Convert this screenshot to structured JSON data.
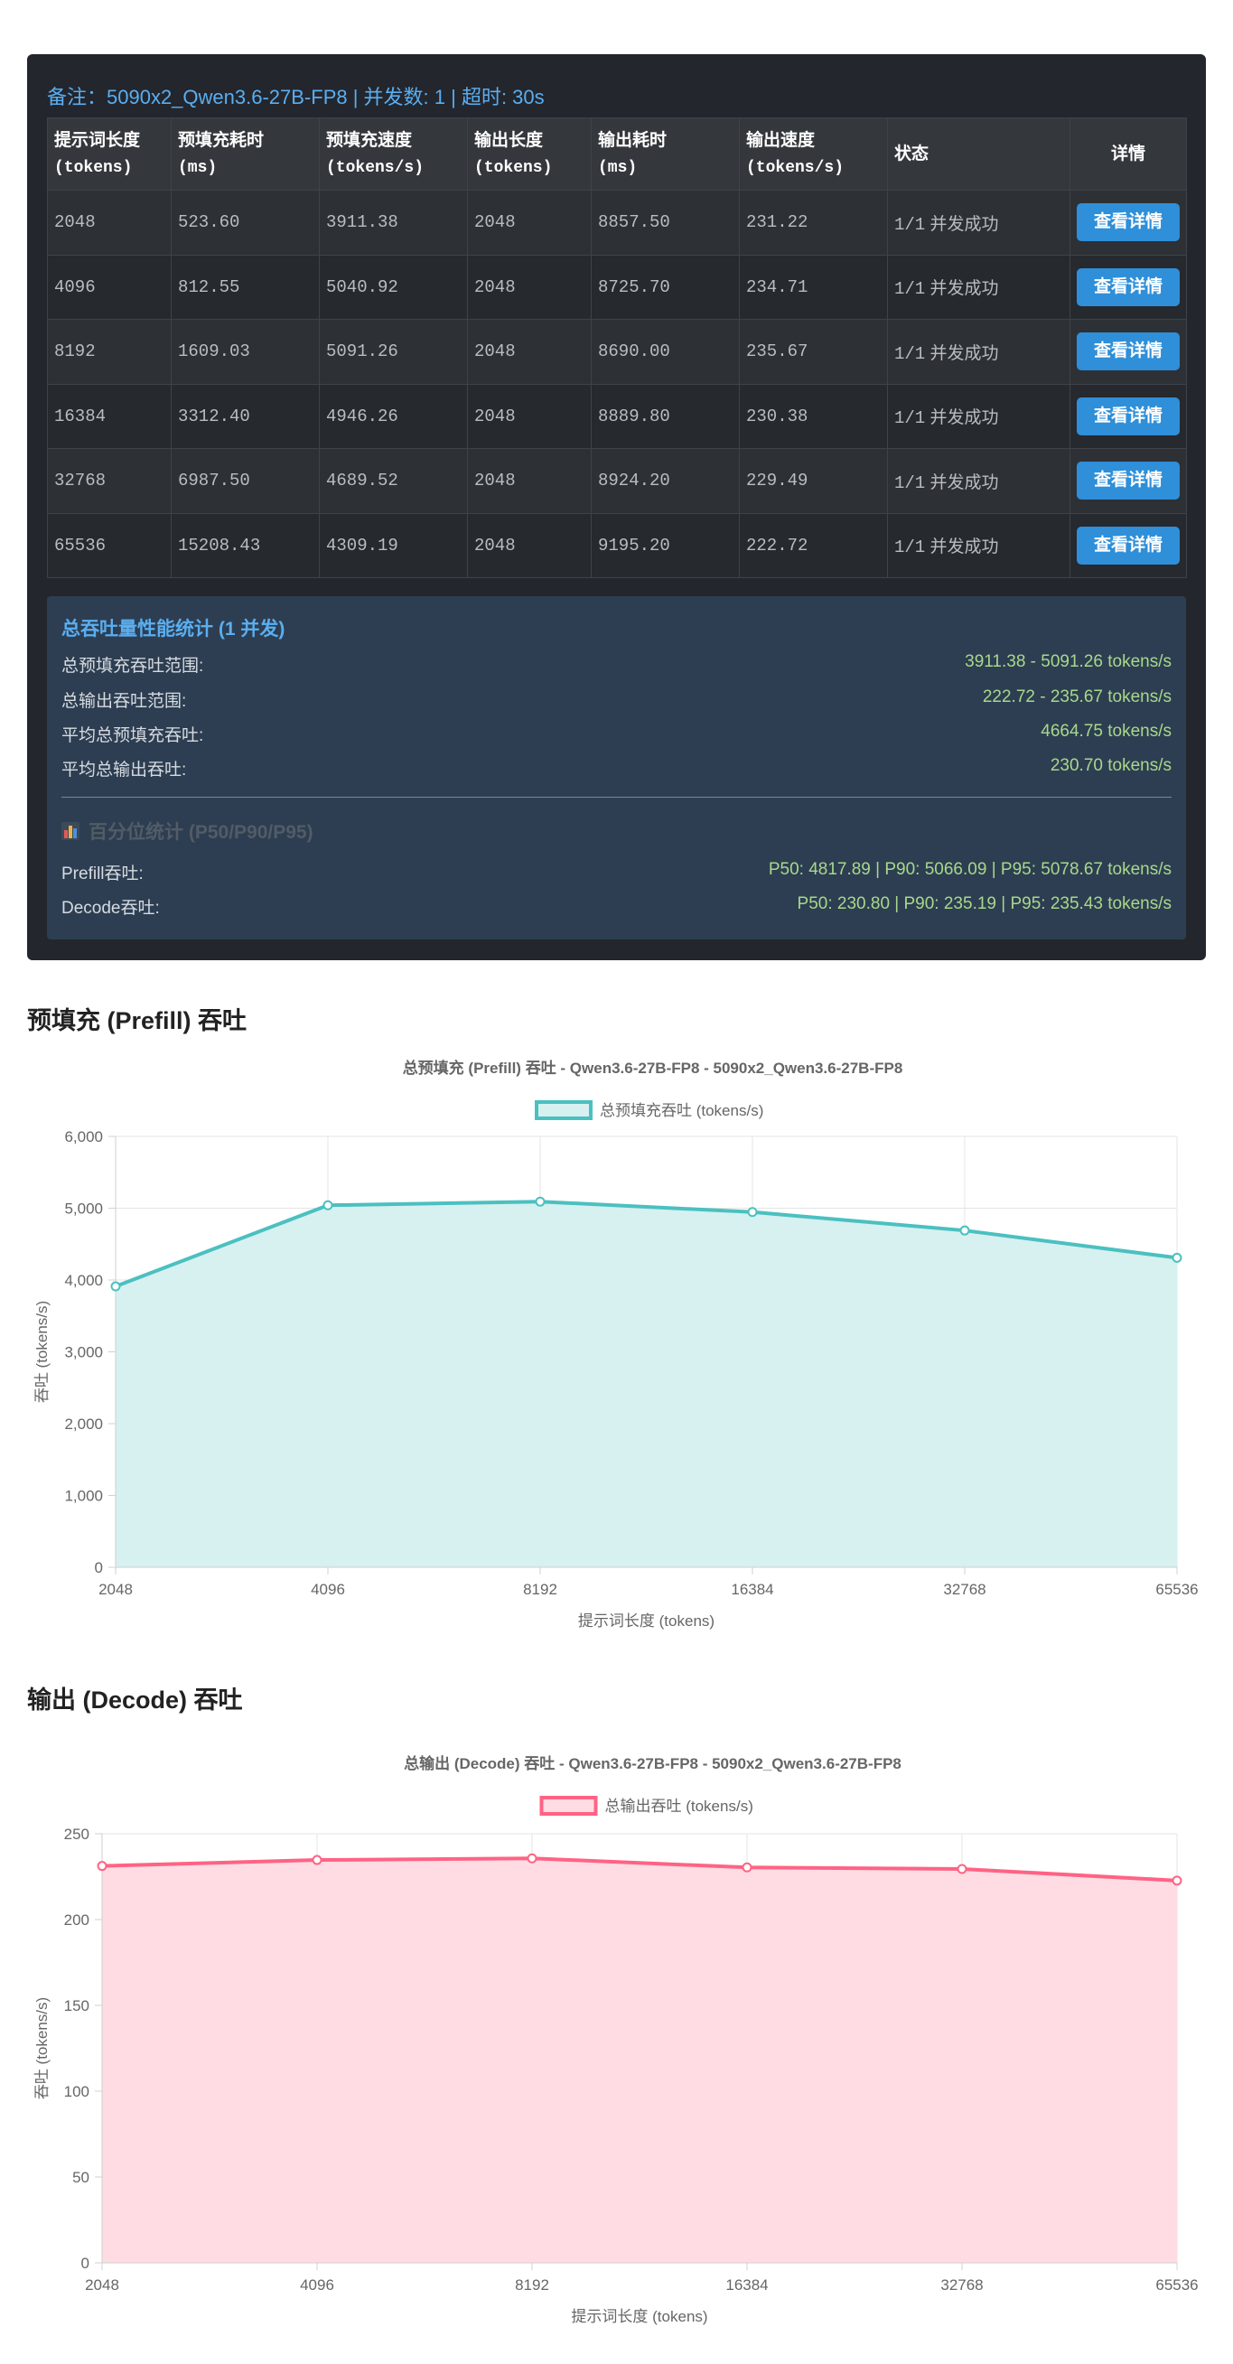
{
  "note": "备注：5090x2_Qwen3.6-27B-FP8 | 并发数: 1 | 超时: 30s",
  "table": {
    "headers": [
      {
        "title": "提示词长度",
        "unit": "(tokens)"
      },
      {
        "title": "预填充耗时",
        "unit": "(ms)"
      },
      {
        "title": "预填充速度",
        "unit": "(tokens/s)"
      },
      {
        "title": "输出长度",
        "unit": "(tokens)"
      },
      {
        "title": "输出耗时",
        "unit": "(ms)"
      },
      {
        "title": "输出速度",
        "unit": "(tokens/s)"
      },
      {
        "title": "状态",
        "unit": ""
      },
      {
        "title": "详情",
        "unit": ""
      }
    ],
    "rows": [
      {
        "prompt_len": "2048",
        "prefill_ms": "523.60",
        "prefill_speed": "3911.38",
        "output_len": "2048",
        "output_ms": "8857.50",
        "output_speed": "231.22",
        "status_frac": "1/1",
        "status_text": "并发成功",
        "button": "查看详情"
      },
      {
        "prompt_len": "4096",
        "prefill_ms": "812.55",
        "prefill_speed": "5040.92",
        "output_len": "2048",
        "output_ms": "8725.70",
        "output_speed": "234.71",
        "status_frac": "1/1",
        "status_text": "并发成功",
        "button": "查看详情"
      },
      {
        "prompt_len": "8192",
        "prefill_ms": "1609.03",
        "prefill_speed": "5091.26",
        "output_len": "2048",
        "output_ms": "8690.00",
        "output_speed": "235.67",
        "status_frac": "1/1",
        "status_text": "并发成功",
        "button": "查看详情"
      },
      {
        "prompt_len": "16384",
        "prefill_ms": "3312.40",
        "prefill_speed": "4946.26",
        "output_len": "2048",
        "output_ms": "8889.80",
        "output_speed": "230.38",
        "status_frac": "1/1",
        "status_text": "并发成功",
        "button": "查看详情"
      },
      {
        "prompt_len": "32768",
        "prefill_ms": "6987.50",
        "prefill_speed": "4689.52",
        "output_len": "2048",
        "output_ms": "8924.20",
        "output_speed": "229.49",
        "status_frac": "1/1",
        "status_text": "并发成功",
        "button": "查看详情"
      },
      {
        "prompt_len": "65536",
        "prefill_ms": "15208.43",
        "prefill_speed": "4309.19",
        "output_len": "2048",
        "output_ms": "9195.20",
        "output_speed": "222.72",
        "status_frac": "1/1",
        "status_text": "并发成功",
        "button": "查看详情"
      }
    ]
  },
  "summary": {
    "title": "总吞吐量性能统计 (1 并发)",
    "rows": [
      {
        "label": "总预填充吞吐范围:",
        "value": "3911.38 - 5091.26 tokens/s"
      },
      {
        "label": "总输出吞吐范围:",
        "value": "222.72 - 235.67 tokens/s"
      },
      {
        "label": "平均总预填充吞吐:",
        "value": "4664.75 tokens/s"
      },
      {
        "label": "平均总输出吞吐:",
        "value": "230.70 tokens/s"
      }
    ],
    "percentile_title": "百分位统计 (P50/P90/P95)",
    "percentile_rows": [
      {
        "label": "Prefill吞吐:",
        "value": "P50: 4817.89 | P90: 5066.09 | P95: 5078.67 tokens/s"
      },
      {
        "label": "Decode吞吐:",
        "value": "P50: 230.80 | P90: 235.19 | P95: 235.43 tokens/s"
      }
    ]
  },
  "sections": {
    "prefill_title": "预填充 (Prefill) 吞吐",
    "decode_title": "输出 (Decode) 吞吐"
  },
  "colors": {
    "prefill_line": "#4bc0c0",
    "prefill_fill": "#d7f0f0",
    "decode_line": "#ff6384",
    "decode_fill": "#ffdce3"
  },
  "chart_data": [
    {
      "type": "area",
      "title": "总预填充 (Prefill) 吞吐 - Qwen3.6-27B-FP8 - 5090x2_Qwen3.6-27B-FP8",
      "categories": [
        "2048",
        "4096",
        "8192",
        "16384",
        "32768",
        "65536"
      ],
      "series": [
        {
          "name": "总预填充吞吐 (tokens/s)",
          "values": [
            3911.38,
            5040.92,
            5091.26,
            4946.26,
            4689.52,
            4309.19
          ]
        }
      ],
      "xlabel": "提示词长度 (tokens)",
      "ylabel": "吞吐 (tokens/s)",
      "ylim": [
        0,
        6000
      ],
      "yticks": [
        0,
        1000,
        2000,
        3000,
        4000,
        5000,
        6000
      ],
      "ytick_labels": [
        "0",
        "1,000",
        "2,000",
        "3,000",
        "4,000",
        "5,000",
        "6,000"
      ],
      "grid": true,
      "legend": "top-center"
    },
    {
      "type": "area",
      "title": "总输出 (Decode) 吞吐 - Qwen3.6-27B-FP8 - 5090x2_Qwen3.6-27B-FP8",
      "categories": [
        "2048",
        "4096",
        "8192",
        "16384",
        "32768",
        "65536"
      ],
      "series": [
        {
          "name": "总输出吞吐 (tokens/s)",
          "values": [
            231.22,
            234.71,
            235.67,
            230.38,
            229.49,
            222.72
          ]
        }
      ],
      "xlabel": "提示词长度 (tokens)",
      "ylabel": "吞吐 (tokens/s)",
      "ylim": [
        0,
        250
      ],
      "yticks": [
        0,
        50,
        100,
        150,
        200,
        250
      ],
      "ytick_labels": [
        "0",
        "50",
        "100",
        "150",
        "200",
        "250"
      ],
      "grid": true,
      "legend": "top-center"
    }
  ]
}
